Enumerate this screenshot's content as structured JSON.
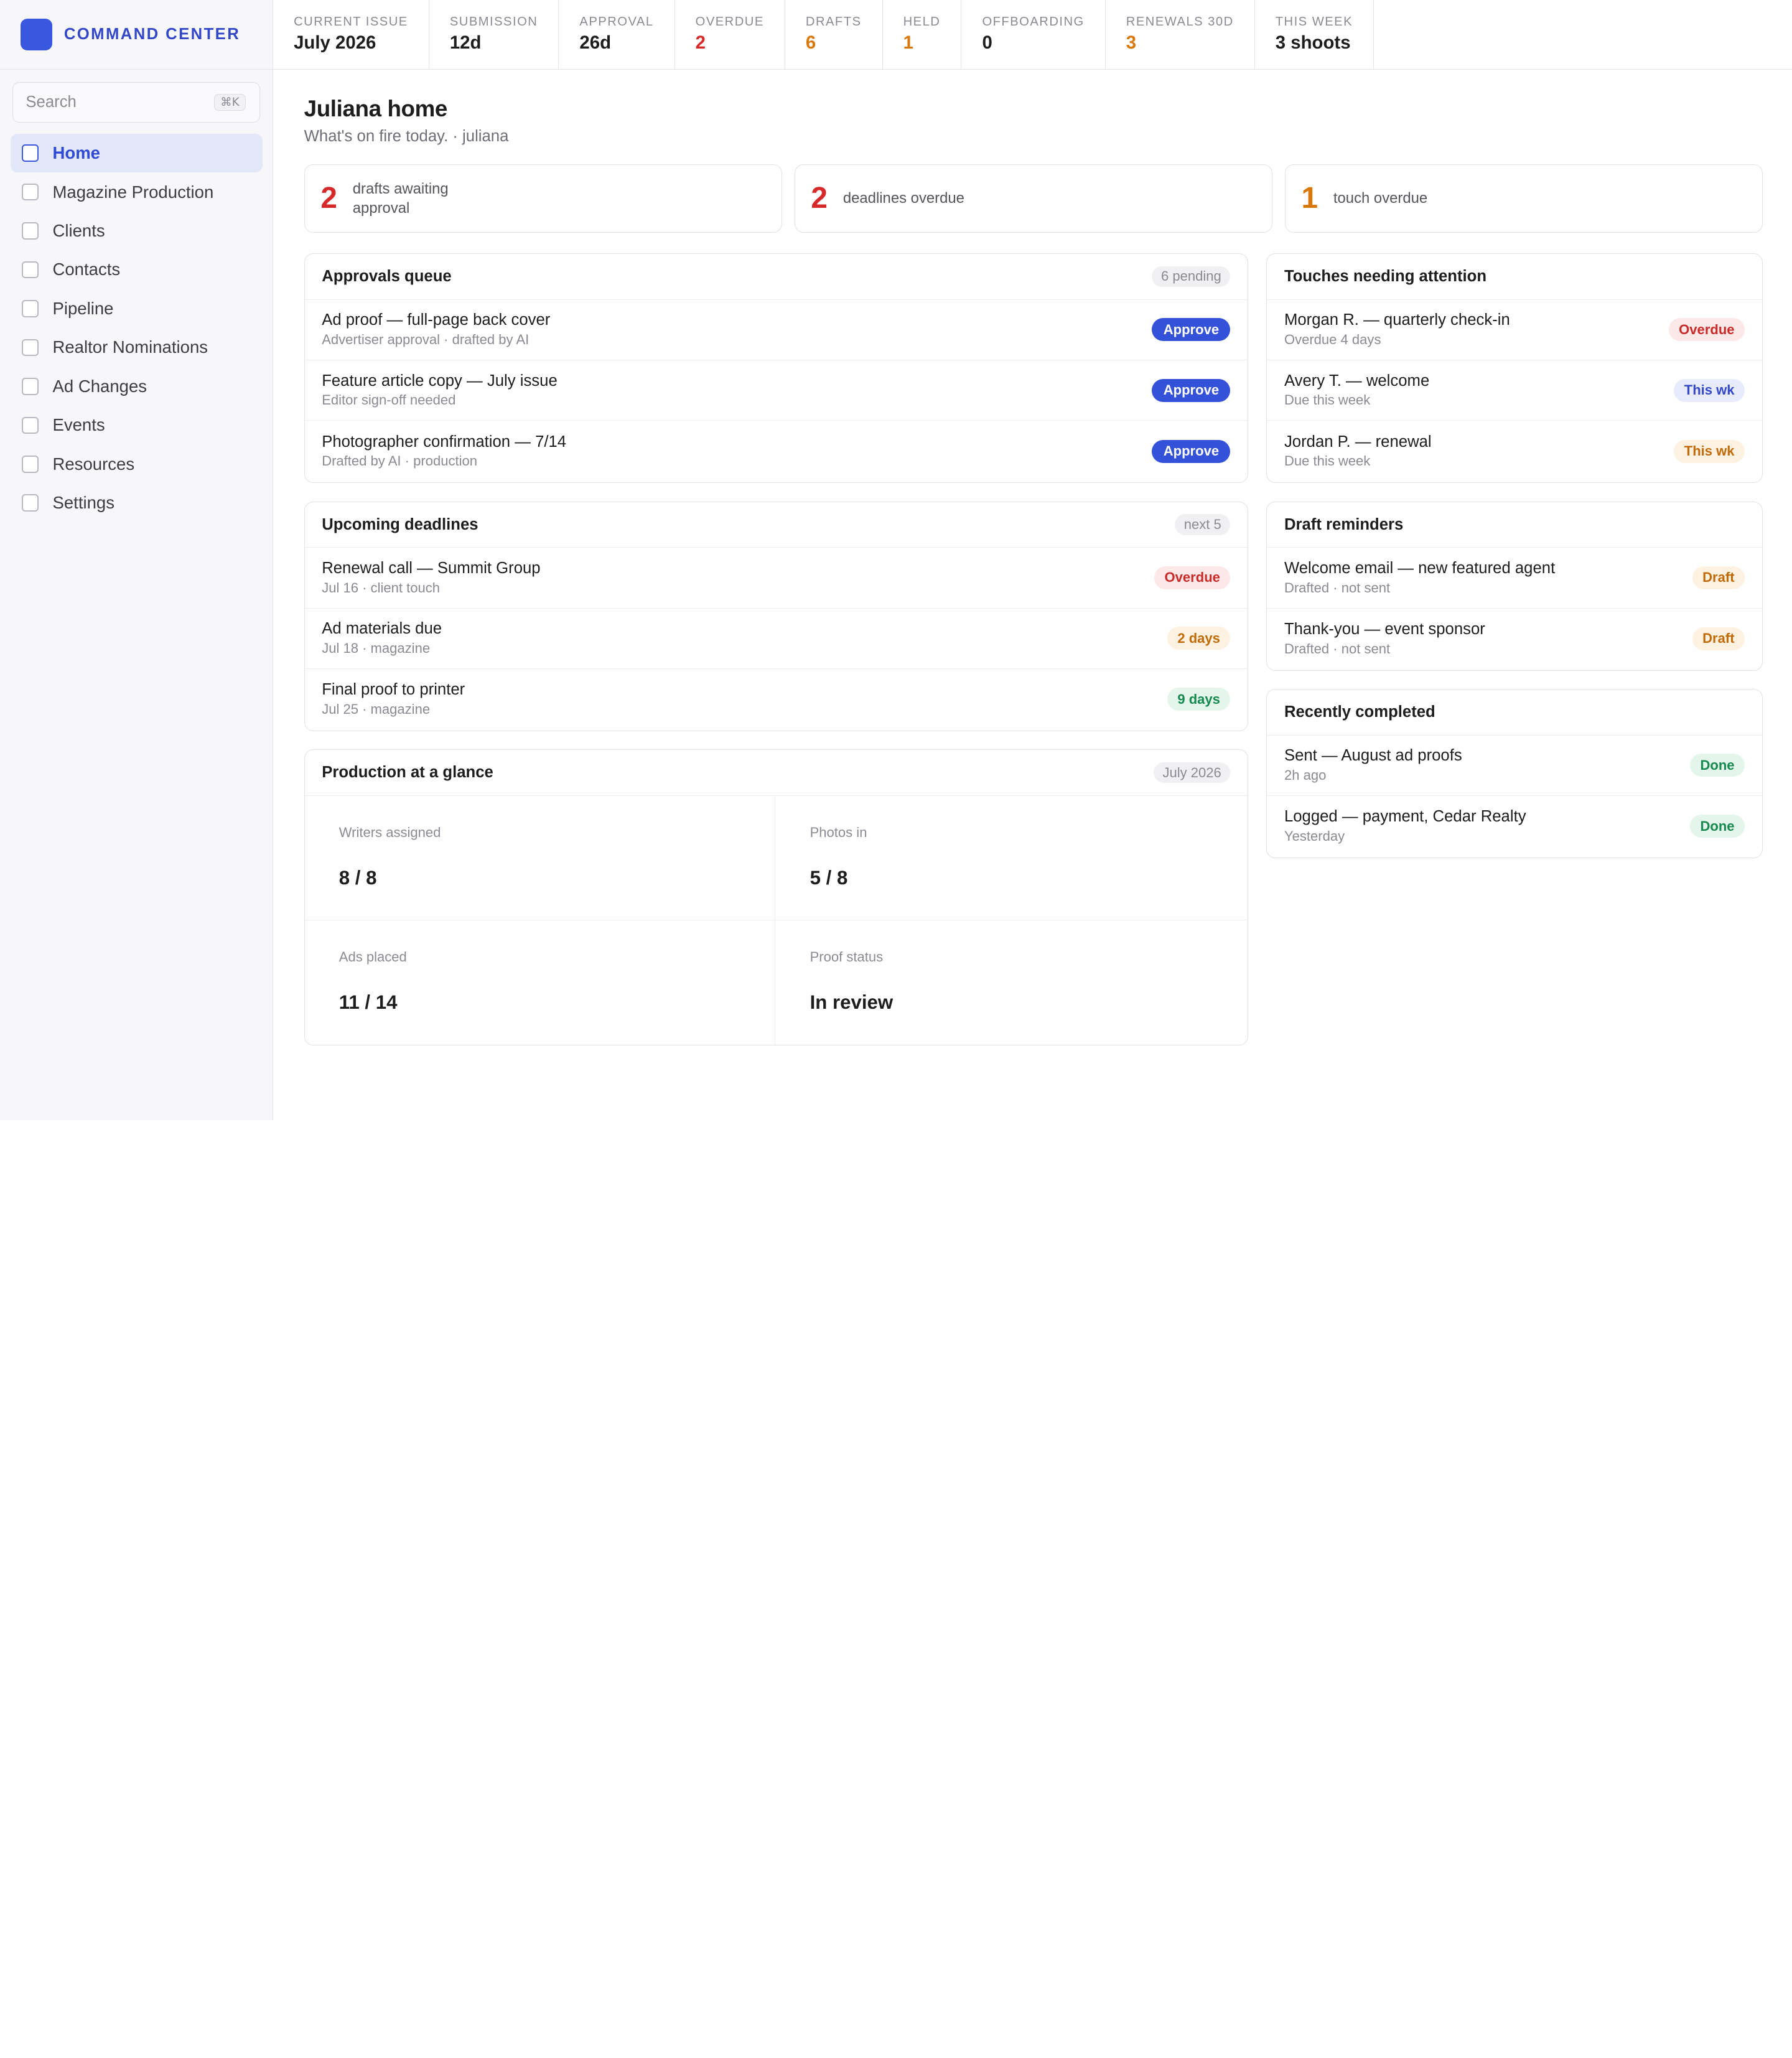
{
  "brand": {
    "name": "COMMAND CENTER",
    "logo_color": "#3a57e0"
  },
  "search": {
    "placeholder": "Search",
    "shortcut": "⌘K"
  },
  "sidebar": {
    "items": [
      {
        "label": "Home",
        "icon": "checkbox-icon",
        "active": true
      },
      {
        "label": "Magazine Production",
        "icon": "checkbox-icon"
      },
      {
        "label": "Clients",
        "icon": "checkbox-icon"
      },
      {
        "label": "Contacts",
        "icon": "checkbox-icon"
      },
      {
        "label": "Pipeline",
        "icon": "checkbox-icon"
      },
      {
        "label": "Realtor Nominations",
        "icon": "checkbox-icon"
      },
      {
        "label": "Ad Changes",
        "icon": "checkbox-icon"
      },
      {
        "label": "Events",
        "icon": "checkbox-icon"
      },
      {
        "label": "Resources",
        "icon": "checkbox-icon"
      },
      {
        "label": "Settings",
        "icon": "checkbox-icon"
      }
    ]
  },
  "stats": [
    {
      "label": "CURRENT ISSUE",
      "value": "July 2026"
    },
    {
      "label": "SUBMISSION",
      "value": "12d"
    },
    {
      "label": "APPROVAL",
      "value": "26d"
    },
    {
      "label": "OVERDUE",
      "value": "2",
      "color": "#d62a2a"
    },
    {
      "label": "DRAFTS",
      "value": "6",
      "color": "#d9780a"
    },
    {
      "label": "HELD",
      "value": "1",
      "color": "#d9780a"
    },
    {
      "label": "OFFBOARDING",
      "value": "0"
    },
    {
      "label": "RENEWALS 30D",
      "value": "3",
      "color": "#d9780a"
    },
    {
      "label": "THIS WEEK",
      "value": "3 shoots"
    }
  ],
  "page": {
    "title": "Juliana home",
    "subtitle": "What's on fire today. · juliana"
  },
  "summary": [
    {
      "count": "2",
      "text": "drafts awaiting approval",
      "color": "#d62a2a"
    },
    {
      "count": "2",
      "text": "deadlines overdue",
      "color": "#d62a2a"
    },
    {
      "count": "1",
      "text": "touch overdue",
      "color": "#d9780a"
    }
  ],
  "approvals": {
    "title": "Approvals queue",
    "count": "6 pending",
    "button_label": "Approve",
    "rows": [
      {
        "title": "Ad proof — full-page back cover",
        "sub": "Advertiser approval · drafted by AI"
      },
      {
        "title": "Feature article copy — July issue",
        "sub": "Editor sign-off needed"
      },
      {
        "title": "Photographer confirmation — 7/14",
        "sub": "Drafted by AI · production"
      }
    ]
  },
  "deadlines": {
    "title": "Upcoming deadlines",
    "count": "next 5",
    "rows": [
      {
        "title": "Renewal call — Summit Group",
        "sub": "Jul 16 · client touch",
        "badge": "Overdue",
        "tone": "overdue"
      },
      {
        "title": "Ad materials due",
        "sub": "Jul 18 · magazine",
        "badge": "2 days",
        "tone": "orange"
      },
      {
        "title": "Final proof to printer",
        "sub": "Jul 25 · magazine",
        "badge": "9 days",
        "tone": "green"
      }
    ]
  },
  "production": {
    "title": "Production at a glance",
    "count": "July 2026",
    "cells": [
      {
        "label": "Writers assigned",
        "value": "8 / 8"
      },
      {
        "label": "Photos in",
        "value": "5 / 8"
      },
      {
        "label": "Ads placed",
        "value": "11 / 14"
      },
      {
        "label": "Proof status",
        "value": "In review"
      }
    ]
  },
  "touches": {
    "title": "Touches needing attention",
    "rows": [
      {
        "title": "Morgan R. — quarterly check-in",
        "sub": "Overdue 4 days",
        "badge": "Overdue",
        "tone": "overdue"
      },
      {
        "title": "Avery T. — welcome",
        "sub": "Due this week",
        "badge": "This wk",
        "tone": "blue"
      },
      {
        "title": "Jordan P. — renewal",
        "sub": "Due this week",
        "badge": "This wk",
        "tone": "orange"
      }
    ]
  },
  "drafts": {
    "title": "Draft reminders",
    "rows": [
      {
        "title": "Welcome email — new featured agent",
        "sub": "Drafted · not sent",
        "badge": "Draft",
        "tone": "orange"
      },
      {
        "title": "Thank-you — event sponsor",
        "sub": "Drafted · not sent",
        "badge": "Draft",
        "tone": "orange"
      }
    ]
  },
  "completed": {
    "title": "Recently completed",
    "rows": [
      {
        "title": "Sent — August ad proofs",
        "sub": "2h ago",
        "badge": "Done",
        "tone": "green"
      },
      {
        "title": "Logged — payment, Cedar Realty",
        "sub": "Yesterday",
        "badge": "Done",
        "tone": "green"
      }
    ]
  }
}
